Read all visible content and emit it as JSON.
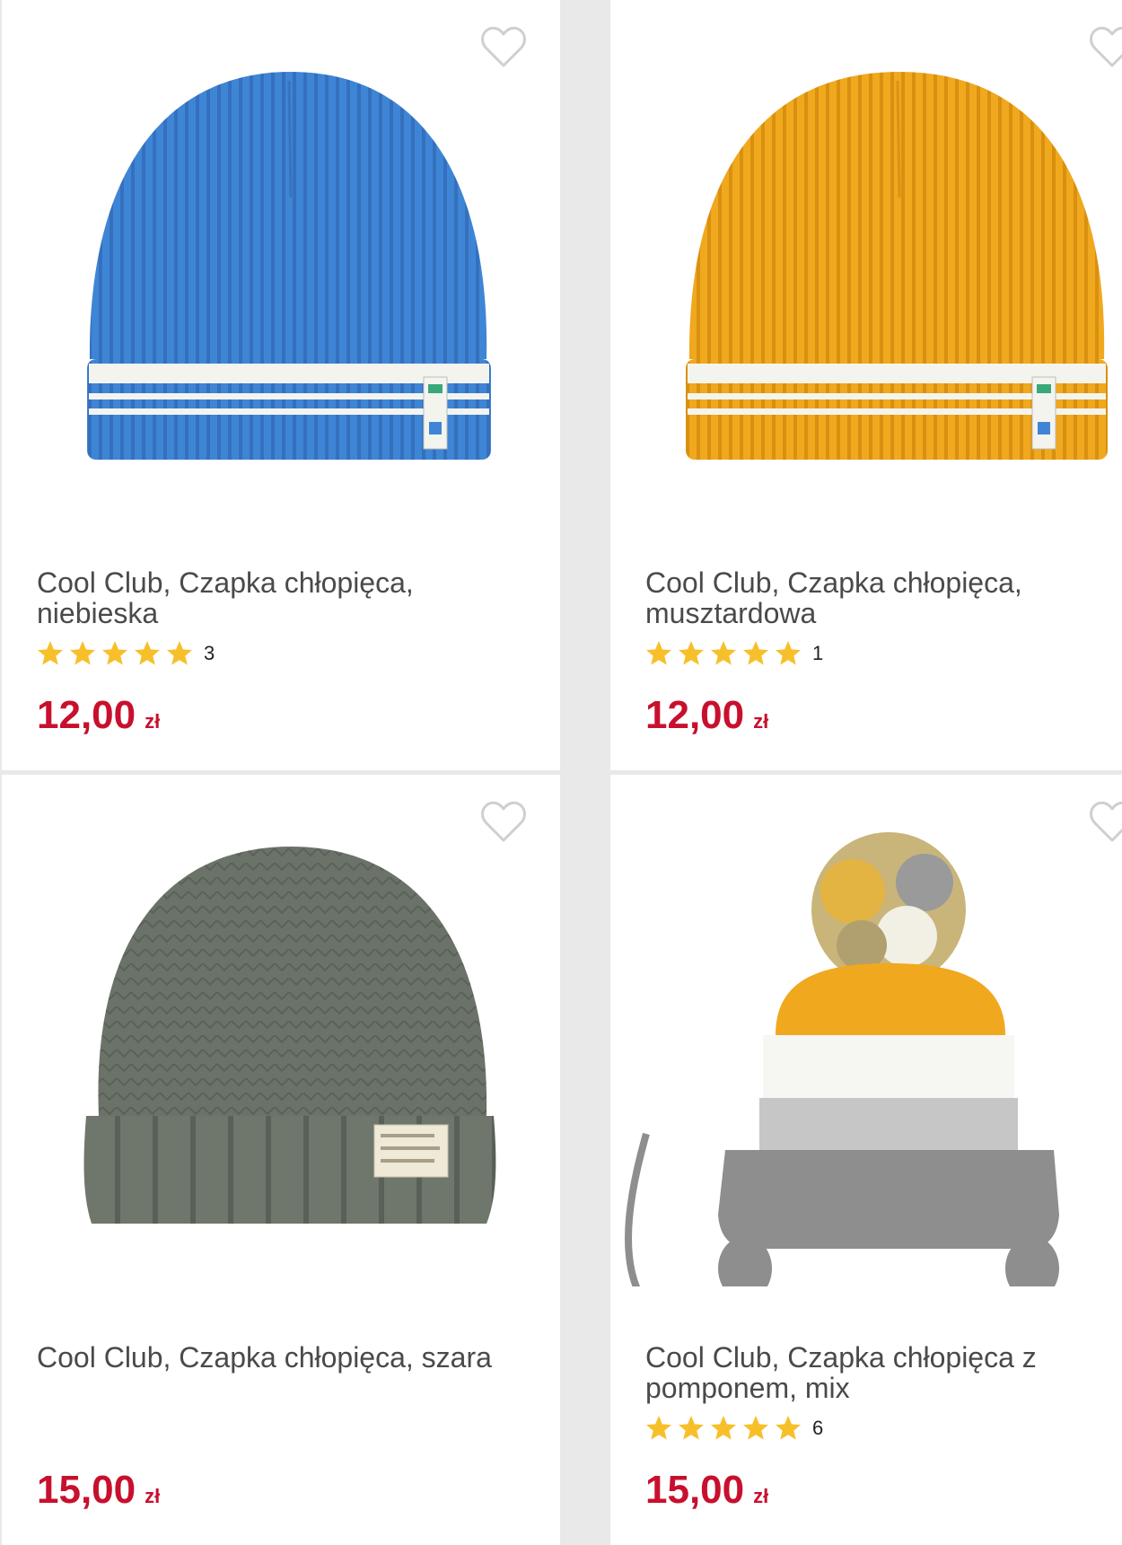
{
  "products": [
    {
      "title": "Cool Club, Czapka chłopięca, niebieska",
      "rating_count": "3",
      "price": "12,00",
      "currency": "zł",
      "color": "#3f85d6"
    },
    {
      "title": "Cool Club, Czapka chłopięca, musztardowa",
      "rating_count": "1",
      "price": "12,00",
      "currency": "zł",
      "color": "#f0a81e"
    },
    {
      "title": "Cool Club, Czapka chłopięca, szara",
      "rating_count": "",
      "price": "15,00",
      "currency": "zł",
      "color": "#6b7369"
    },
    {
      "title": "Cool Club, Czapka chłopięca z pomponem, mix",
      "rating_count": "6",
      "price": "15,00",
      "currency": "zł",
      "color": "#8a8a8a"
    }
  ],
  "icons": {
    "favorite": "heart-outline-icon",
    "rating": "star-icon"
  },
  "colors": {
    "price": "#c8102e",
    "star": "#f7c02a",
    "heart": "#cfcfcf"
  }
}
